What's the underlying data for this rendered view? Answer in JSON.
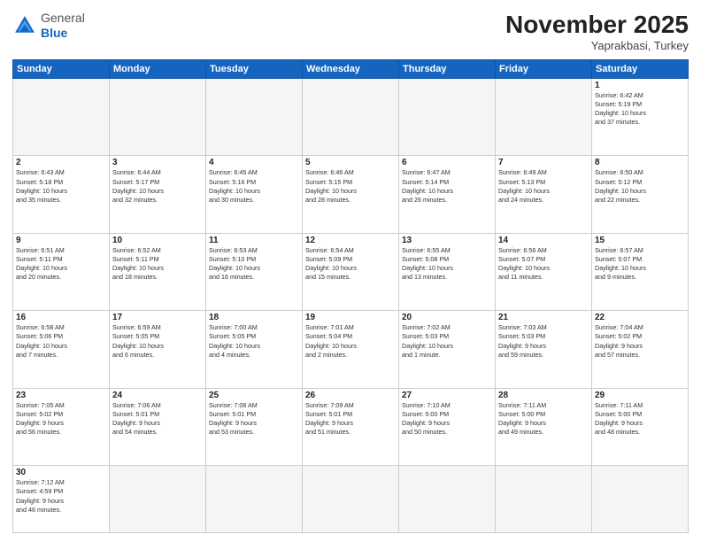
{
  "header": {
    "month_title": "November 2025",
    "location": "Yaprakbasi, Turkey",
    "logo_general": "General",
    "logo_blue": "Blue"
  },
  "weekdays": [
    "Sunday",
    "Monday",
    "Tuesday",
    "Wednesday",
    "Thursday",
    "Friday",
    "Saturday"
  ],
  "days": {
    "d1": {
      "num": "1",
      "sunrise": "6:42 AM",
      "sunset": "5:19 PM",
      "daylight": "10 hours and 37 minutes."
    },
    "d2": {
      "num": "2",
      "sunrise": "6:43 AM",
      "sunset": "5:18 PM",
      "daylight": "10 hours and 35 minutes."
    },
    "d3": {
      "num": "3",
      "sunrise": "6:44 AM",
      "sunset": "5:17 PM",
      "daylight": "10 hours and 32 minutes."
    },
    "d4": {
      "num": "4",
      "sunrise": "6:45 AM",
      "sunset": "5:16 PM",
      "daylight": "10 hours and 30 minutes."
    },
    "d5": {
      "num": "5",
      "sunrise": "6:46 AM",
      "sunset": "5:15 PM",
      "daylight": "10 hours and 28 minutes."
    },
    "d6": {
      "num": "6",
      "sunrise": "6:47 AM",
      "sunset": "5:14 PM",
      "daylight": "10 hours and 26 minutes."
    },
    "d7": {
      "num": "7",
      "sunrise": "6:49 AM",
      "sunset": "5:13 PM",
      "daylight": "10 hours and 24 minutes."
    },
    "d8": {
      "num": "8",
      "sunrise": "6:50 AM",
      "sunset": "5:12 PM",
      "daylight": "10 hours and 22 minutes."
    },
    "d9": {
      "num": "9",
      "sunrise": "6:51 AM",
      "sunset": "5:11 PM",
      "daylight": "10 hours and 20 minutes."
    },
    "d10": {
      "num": "10",
      "sunrise": "6:52 AM",
      "sunset": "5:11 PM",
      "daylight": "10 hours and 18 minutes."
    },
    "d11": {
      "num": "11",
      "sunrise": "6:53 AM",
      "sunset": "5:10 PM",
      "daylight": "10 hours and 16 minutes."
    },
    "d12": {
      "num": "12",
      "sunrise": "6:54 AM",
      "sunset": "5:09 PM",
      "daylight": "10 hours and 15 minutes."
    },
    "d13": {
      "num": "13",
      "sunrise": "6:55 AM",
      "sunset": "5:08 PM",
      "daylight": "10 hours and 13 minutes."
    },
    "d14": {
      "num": "14",
      "sunrise": "6:56 AM",
      "sunset": "5:07 PM",
      "daylight": "10 hours and 11 minutes."
    },
    "d15": {
      "num": "15",
      "sunrise": "6:57 AM",
      "sunset": "5:07 PM",
      "daylight": "10 hours and 9 minutes."
    },
    "d16": {
      "num": "16",
      "sunrise": "6:58 AM",
      "sunset": "5:06 PM",
      "daylight": "10 hours and 7 minutes."
    },
    "d17": {
      "num": "17",
      "sunrise": "6:59 AM",
      "sunset": "5:05 PM",
      "daylight": "10 hours and 6 minutes."
    },
    "d18": {
      "num": "18",
      "sunrise": "7:00 AM",
      "sunset": "5:05 PM",
      "daylight": "10 hours and 4 minutes."
    },
    "d19": {
      "num": "19",
      "sunrise": "7:01 AM",
      "sunset": "5:04 PM",
      "daylight": "10 hours and 2 minutes."
    },
    "d20": {
      "num": "20",
      "sunrise": "7:02 AM",
      "sunset": "5:03 PM",
      "daylight": "10 hours and 1 minute."
    },
    "d21": {
      "num": "21",
      "sunrise": "7:03 AM",
      "sunset": "5:03 PM",
      "daylight": "9 hours and 59 minutes."
    },
    "d22": {
      "num": "22",
      "sunrise": "7:04 AM",
      "sunset": "5:02 PM",
      "daylight": "9 hours and 57 minutes."
    },
    "d23": {
      "num": "23",
      "sunrise": "7:05 AM",
      "sunset": "5:02 PM",
      "daylight": "9 hours and 56 minutes."
    },
    "d24": {
      "num": "24",
      "sunrise": "7:06 AM",
      "sunset": "5:01 PM",
      "daylight": "9 hours and 54 minutes."
    },
    "d25": {
      "num": "25",
      "sunrise": "7:08 AM",
      "sunset": "5:01 PM",
      "daylight": "9 hours and 53 minutes."
    },
    "d26": {
      "num": "26",
      "sunrise": "7:09 AM",
      "sunset": "5:01 PM",
      "daylight": "9 hours and 51 minutes."
    },
    "d27": {
      "num": "27",
      "sunrise": "7:10 AM",
      "sunset": "5:00 PM",
      "daylight": "9 hours and 50 minutes."
    },
    "d28": {
      "num": "28",
      "sunrise": "7:11 AM",
      "sunset": "5:00 PM",
      "daylight": "9 hours and 49 minutes."
    },
    "d29": {
      "num": "29",
      "sunrise": "7:11 AM",
      "sunset": "5:00 PM",
      "daylight": "9 hours and 48 minutes."
    },
    "d30": {
      "num": "30",
      "sunrise": "7:12 AM",
      "sunset": "4:59 PM",
      "daylight": "9 hours and 46 minutes."
    }
  }
}
